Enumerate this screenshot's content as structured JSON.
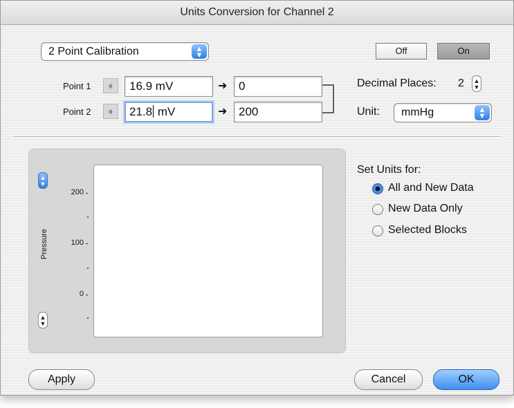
{
  "window": {
    "title": "Units Conversion for Channel 2"
  },
  "calibration": {
    "mode": "2 Point Calibration"
  },
  "toggle": {
    "off_label": "Off",
    "on_label": "On"
  },
  "points": [
    {
      "label": "Point 1",
      "input_value": "16.9 mV",
      "output_value": "0"
    },
    {
      "label": "Point 2",
      "input_value_before_caret": "21.8",
      "input_value_after_caret": " mV",
      "output_value": "200"
    }
  ],
  "decimal_places": {
    "label": "Decimal Places:",
    "value": "2"
  },
  "unit": {
    "label": "Unit:",
    "value": "mmHg"
  },
  "plot": {
    "ylabel": "Pressure",
    "yticks": [
      "200",
      "100",
      "0"
    ]
  },
  "set_units": {
    "label": "Set Units for:",
    "options": [
      "All and New Data",
      "New Data Only",
      "Selected Blocks"
    ],
    "selected_index": 0
  },
  "buttons": {
    "apply": "Apply",
    "cancel": "Cancel",
    "ok": "OK"
  },
  "icons": {
    "popup_arrows": "up-down-arrows-icon",
    "gray_arrow": "right-arrow-icon",
    "black_arrow": "right-arrow-icon",
    "stepper": "stepper-icon",
    "bracket": "bracket-connector"
  },
  "colors": {
    "accent": "#2f7ee6",
    "on_toggle": "#a8a8a8",
    "panel": "#d7d7d7"
  }
}
